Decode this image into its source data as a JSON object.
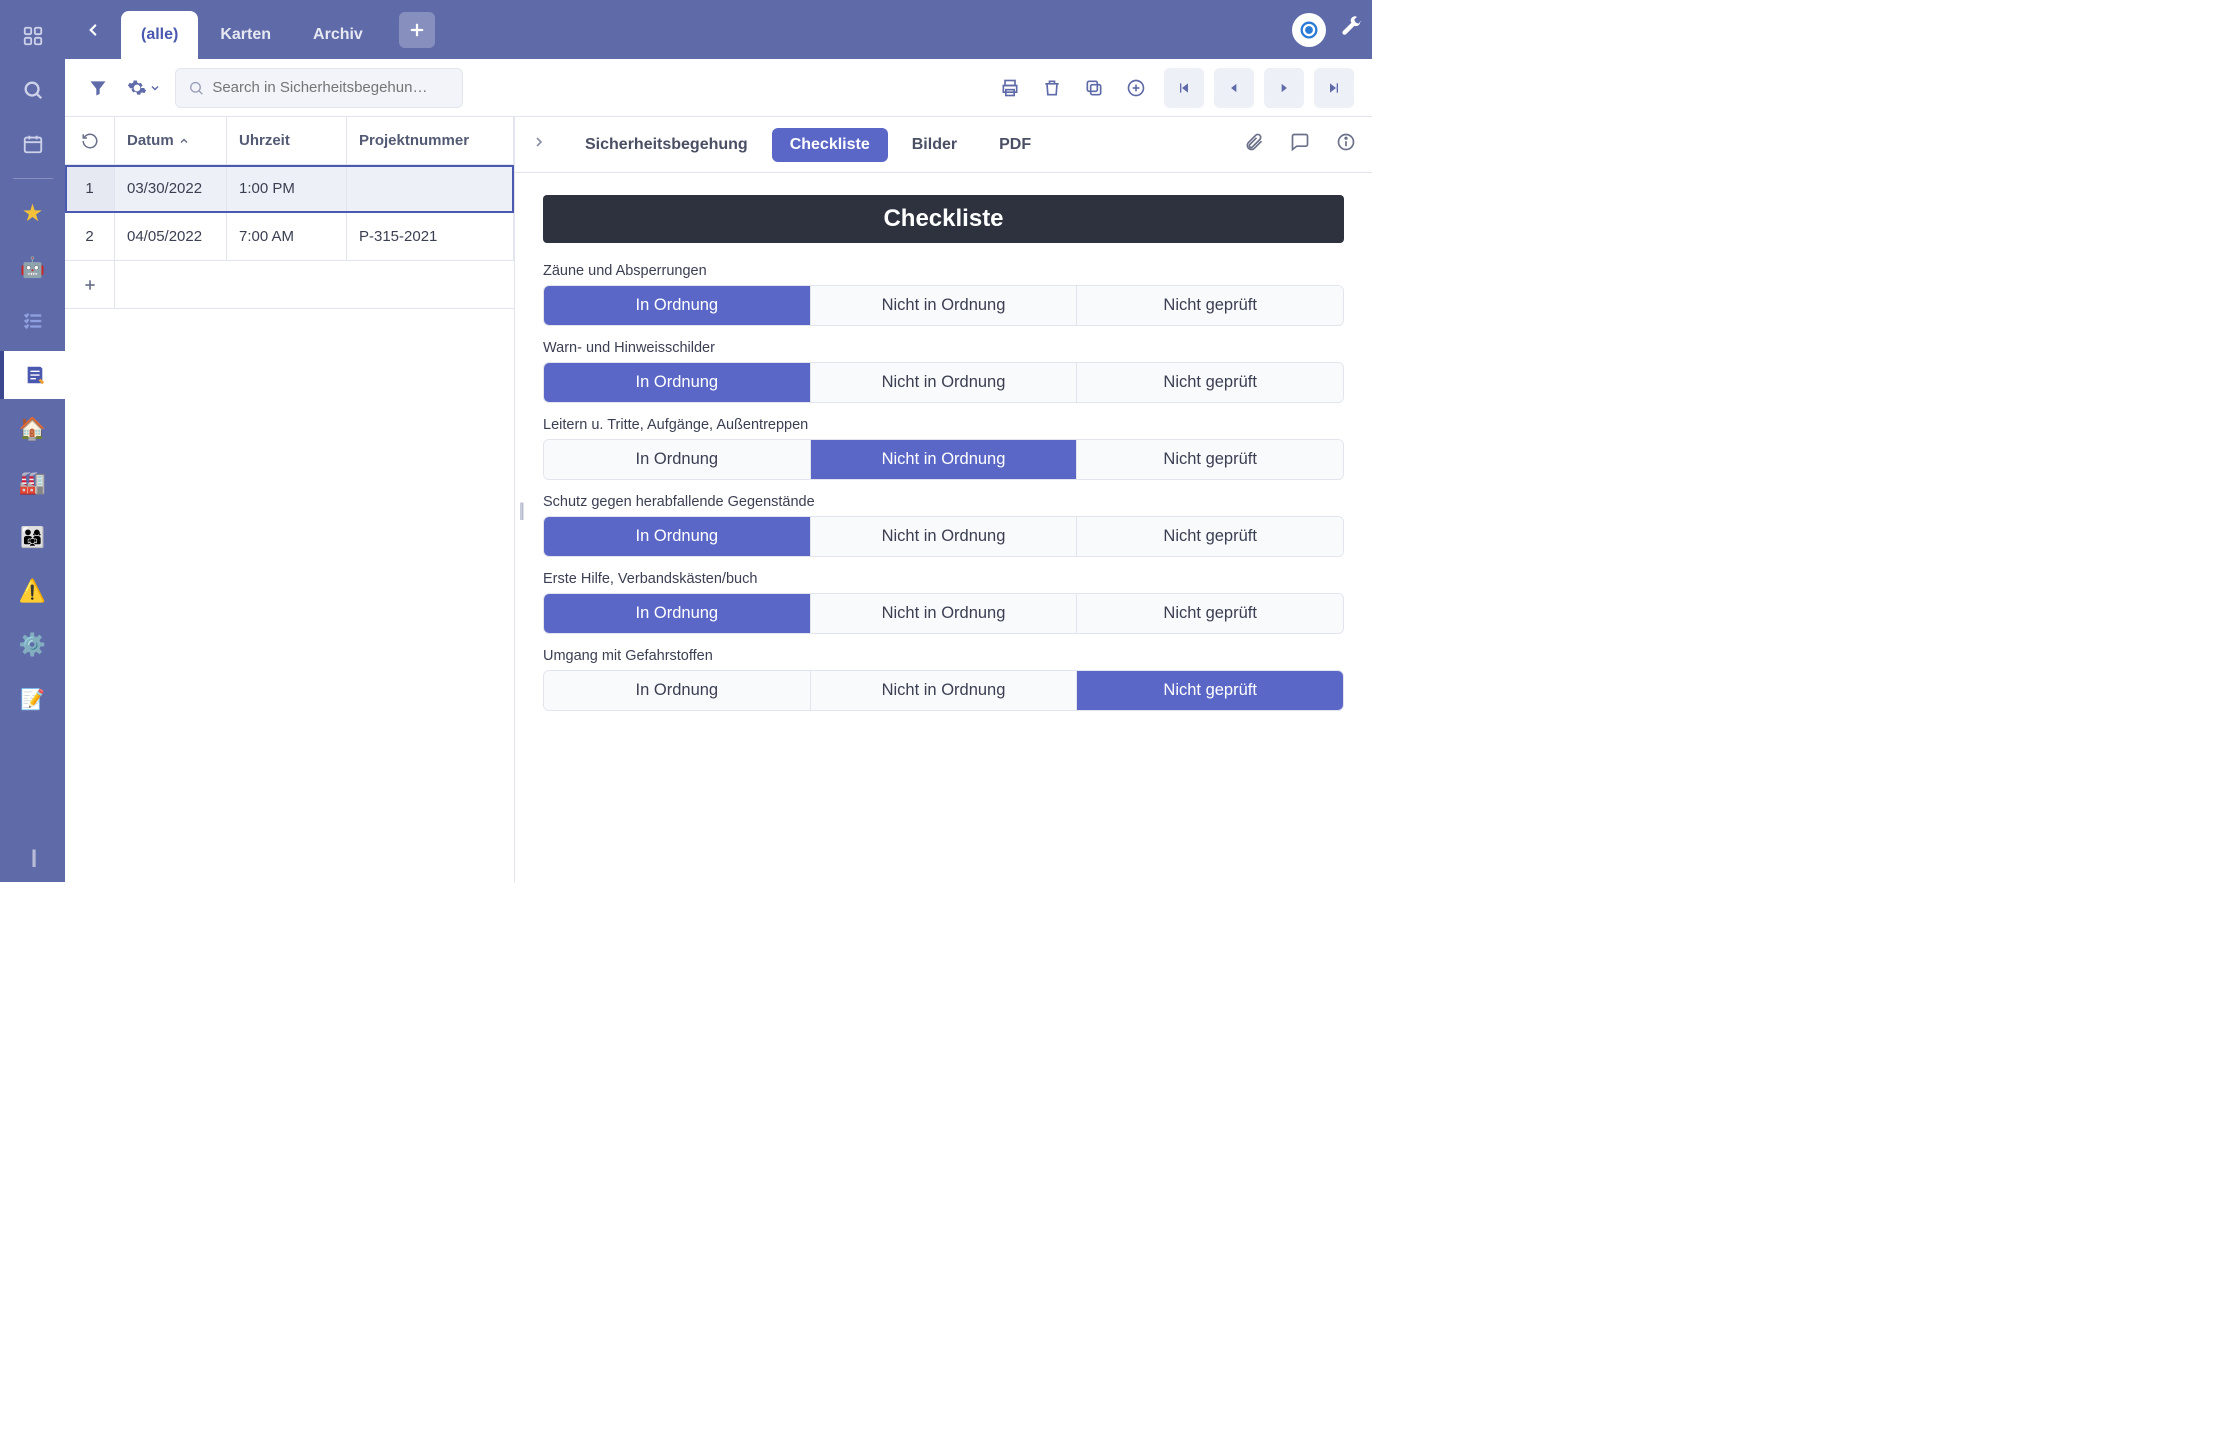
{
  "colors": {
    "primary": "#5f6aa8",
    "accent": "#5b67c7",
    "bannerBg": "#2d323e"
  },
  "topbar": {
    "tabs": [
      {
        "label": "(alle)",
        "active": true
      },
      {
        "label": "Karten",
        "active": false
      },
      {
        "label": "Archiv",
        "active": false
      }
    ],
    "addIcon": "plus-icon"
  },
  "toolbar": {
    "searchPlaceholder": "Search in Sicherheitsbegehun…"
  },
  "rail": {
    "items": [
      {
        "name": "back",
        "icon": "chevron-left"
      },
      {
        "name": "apps",
        "icon": "grid"
      },
      {
        "name": "search",
        "icon": "search"
      },
      {
        "name": "calendar",
        "icon": "calendar"
      },
      {
        "name": "favorites",
        "icon": "star"
      },
      {
        "name": "robot",
        "icon": "robot"
      },
      {
        "name": "checklist",
        "icon": "list-check"
      },
      {
        "name": "notes",
        "icon": "note",
        "selected": true
      },
      {
        "name": "home",
        "icon": "house"
      },
      {
        "name": "factory",
        "icon": "factory"
      },
      {
        "name": "people",
        "icon": "people"
      },
      {
        "name": "warning",
        "icon": "warning"
      },
      {
        "name": "settings",
        "icon": "gear"
      },
      {
        "name": "edit",
        "icon": "edit"
      }
    ]
  },
  "grid": {
    "headers": {
      "datum": "Datum",
      "uhrzeit": "Uhrzeit",
      "projekt": "Projektnummer"
    },
    "rows": [
      {
        "n": "1",
        "datum": "03/30/2022",
        "uhr": "1:00 PM",
        "proj": "",
        "selected": true
      },
      {
        "n": "2",
        "datum": "04/05/2022",
        "uhr": "7:00 AM",
        "proj": "P-315-2021",
        "selected": false
      }
    ]
  },
  "detail": {
    "tabs": [
      {
        "label": "Sicherheitsbegehung",
        "active": false
      },
      {
        "label": "Checkliste",
        "active": true
      },
      {
        "label": "Bilder",
        "active": false
      },
      {
        "label": "PDF",
        "active": false
      }
    ],
    "bannerTitle": "Checkliste",
    "options": {
      "ok": "In Ordnung",
      "nok": "Nicht in Ordnung",
      "nc": "Nicht geprüft"
    },
    "items": [
      {
        "label": "Zäune und Absperrungen",
        "value": "ok"
      },
      {
        "label": "Warn- und Hinweisschilder",
        "value": "ok"
      },
      {
        "label": "Leitern u. Tritte, Aufgänge, Außentreppen",
        "value": "nok"
      },
      {
        "label": "Schutz gegen herabfallende Gegenstände",
        "value": "ok"
      },
      {
        "label": "Erste Hilfe, Verbandskästen/buch",
        "value": "ok"
      },
      {
        "label": "Umgang mit Gefahrstoffen",
        "value": "nc"
      }
    ]
  }
}
